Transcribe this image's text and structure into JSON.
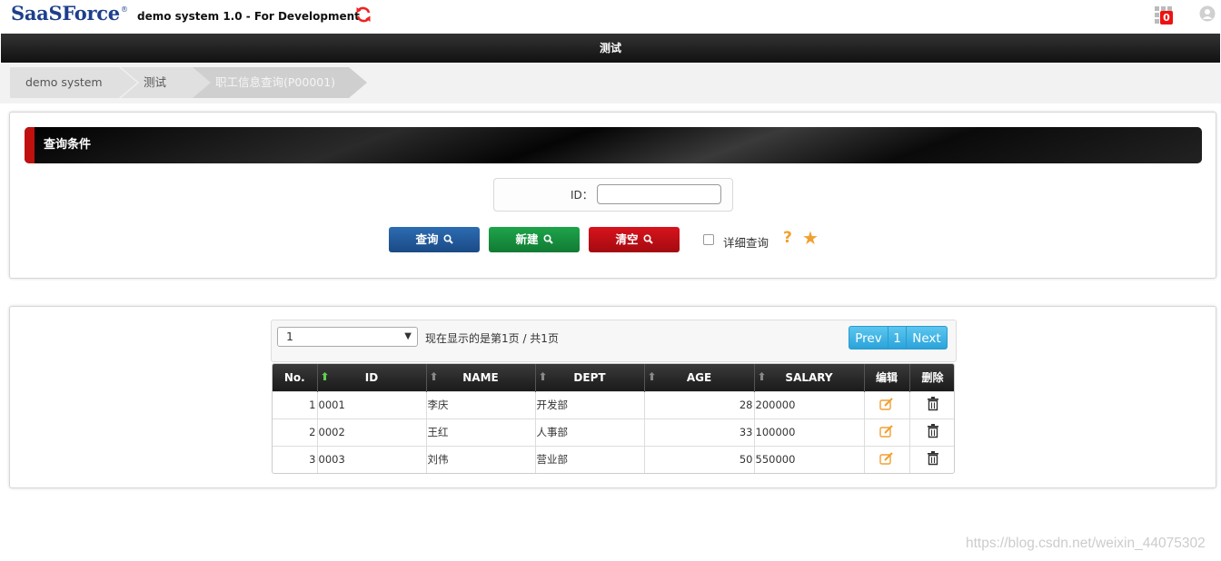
{
  "header": {
    "logo": "SaaSForce",
    "logo_mark": "®",
    "system_title": "demo system 1.0 - For Development",
    "notification_count": "0",
    "icons": [
      "refresh-icon",
      "apps-grid-icon",
      "user-icon"
    ]
  },
  "nav": {
    "title": "测试"
  },
  "breadcrumb": [
    "demo system",
    "测试",
    "职工信息查询(P00001)"
  ],
  "search": {
    "section_title": "查询条件",
    "id_label": "ID：",
    "id_value": "",
    "buttons": {
      "query": "查询",
      "new": "新建",
      "clear": "清空"
    },
    "detail_checkbox_label": "详细查询",
    "detail_checked": false,
    "help": "?",
    "favorite": "★"
  },
  "pager": {
    "selected_page": "1",
    "info": "现在显示的是第1页 / 共1页",
    "prev": "Prev",
    "current": "1",
    "next": "Next"
  },
  "table": {
    "columns": [
      "No.",
      "ID",
      "NAME",
      "DEPT",
      "AGE",
      "SALARY",
      "编辑",
      "删除"
    ],
    "rows": [
      {
        "no": "1",
        "id": "0001",
        "name": "李庆",
        "dept": "开发部",
        "age": "28",
        "salary": "200000"
      },
      {
        "no": "2",
        "id": "0002",
        "name": "王红",
        "dept": "人事部",
        "age": "33",
        "salary": "100000"
      },
      {
        "no": "3",
        "id": "0003",
        "name": "刘伟",
        "dept": "营业部",
        "age": "50",
        "salary": "550000"
      }
    ]
  },
  "watermark": "https://blog.csdn.net/weixin_44075302",
  "colors": {
    "brand": "#1d3f8c",
    "query_button": "#1a4a85",
    "new_button": "#117a33",
    "clear_button": "#a30a10",
    "accent": "#f0a030",
    "pager": "#2aa3da"
  }
}
